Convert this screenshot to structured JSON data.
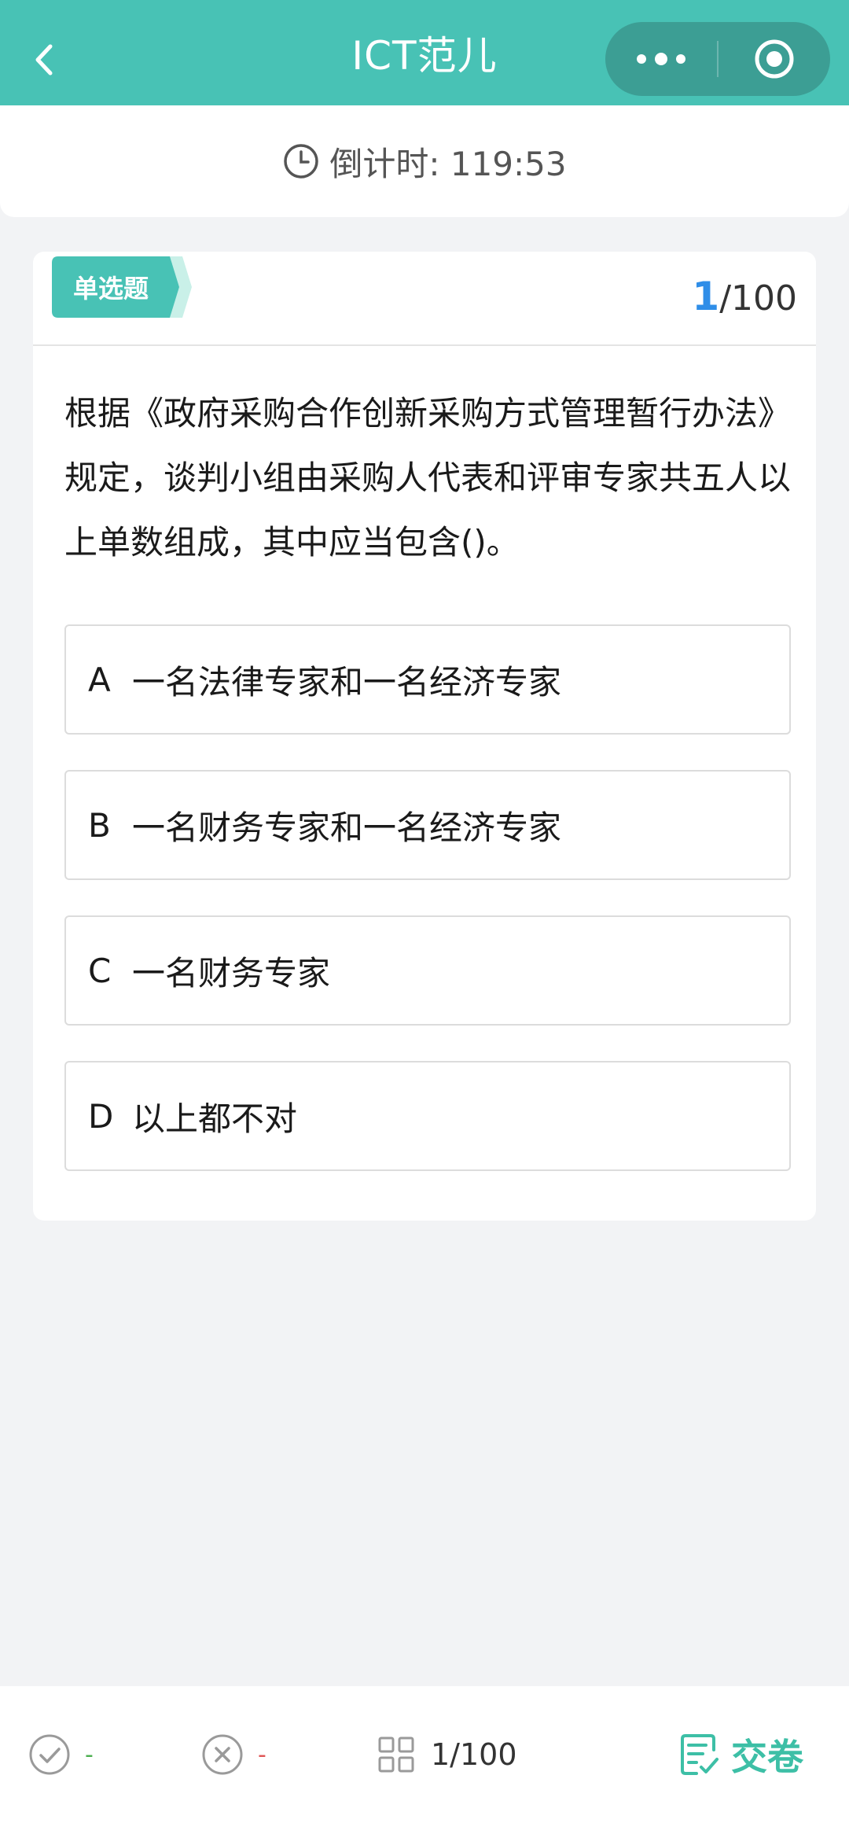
{
  "header": {
    "title": "ICT范儿"
  },
  "timer": {
    "label": "倒计时: 119:53"
  },
  "question": {
    "type_label": "单选题",
    "current_index": "1",
    "total_text": "/100",
    "text": "根据《政府采购合作创新采购方式管理暂行办法》规定，谈判小组由采购人代表和评审专家共五人以上单数组成，其中应当包含()。",
    "options": [
      {
        "letter": "A",
        "text": "一名法律专家和一名经济专家"
      },
      {
        "letter": "B",
        "text": "一名财务专家和一名经济专家"
      },
      {
        "letter": "C",
        "text": "一名财务专家"
      },
      {
        "letter": "D",
        "text": "以上都不对"
      }
    ]
  },
  "bottom": {
    "correct_count": "-",
    "wrong_count": "-",
    "progress": "1/100",
    "submit_label": "交卷"
  },
  "colors": {
    "brand": "#48c2b5",
    "accent_blue": "#2f8ee8",
    "submit_green": "#3dbfa6",
    "correct_green": "#4caf50",
    "wrong_red": "#e05555"
  },
  "icons": [
    "back-icon",
    "more-icon",
    "close-target-icon",
    "clock-icon",
    "correct-icon",
    "wrong-icon",
    "grid-icon",
    "submit-icon"
  ]
}
